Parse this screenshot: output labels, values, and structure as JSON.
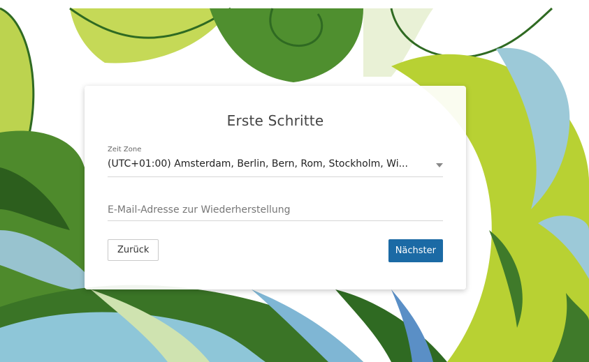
{
  "colors": {
    "accent": "#1b6aa5",
    "background_green_light": "#a9c93a",
    "background_green_dark": "#3f7a2a",
    "background_blue": "#8ec6d8"
  },
  "dialog": {
    "title": "Erste Schritte",
    "timezone": {
      "label": "Zeit Zone",
      "value": "(UTC+01:00) Amsterdam, Berlin, Bern, Rom, Stockholm, Wi...",
      "icon": "chevron-down-icon"
    },
    "recovery_email": {
      "value": "",
      "placeholder": "E-Mail-Adresse zur Wiederherstellung"
    },
    "back_label": "Zurück",
    "next_label": "Nächster"
  }
}
